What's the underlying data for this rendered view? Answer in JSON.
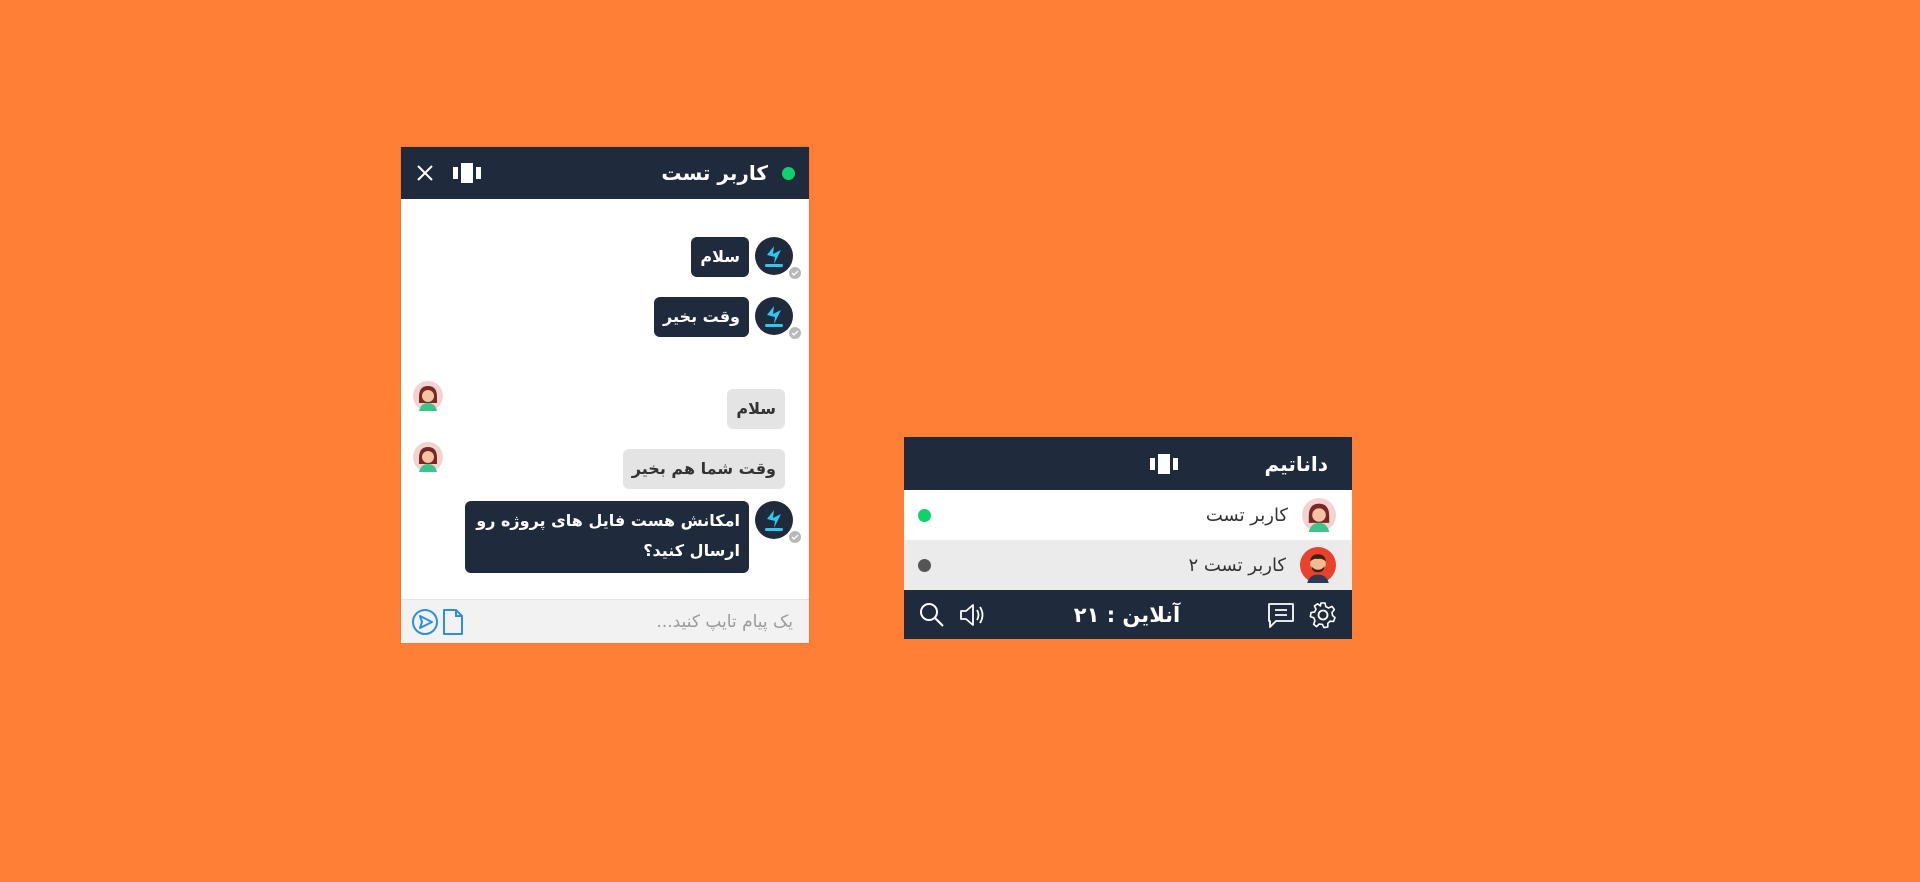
{
  "colors": {
    "background": "#ff7f37",
    "header_dark": "#1f2a3c",
    "online_green": "#0ed36a",
    "offline_gray": "#555555",
    "accent_blue": "#2d8fe0"
  },
  "chat": {
    "title": "کاربر تست",
    "status": "online",
    "messages": [
      {
        "direction": "out",
        "text": "سلام"
      },
      {
        "direction": "out",
        "text": "وقت بخیر"
      },
      {
        "direction": "in",
        "text": "سلام"
      },
      {
        "direction": "in",
        "text": "وقت شما هم بخیر"
      },
      {
        "direction": "out",
        "text": "امکانش هست فایل های پروژه رو ارسال کنید؟"
      }
    ],
    "input_placeholder": "یک پیام تایپ کنید..."
  },
  "panel": {
    "title": "داناتیم",
    "contacts": [
      {
        "name": "کاربر تست",
        "status": "online"
      },
      {
        "name": "کاربر تست ۲",
        "status": "offline"
      }
    ],
    "online_label": "آنلاین : ۲۱"
  }
}
